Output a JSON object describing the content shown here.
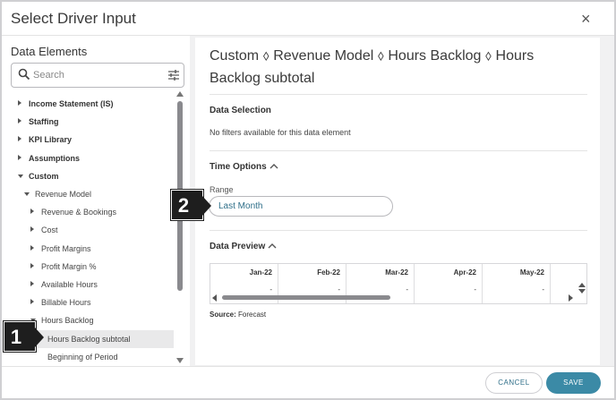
{
  "dialog": {
    "title": "Select Driver Input",
    "close_symbol": "×"
  },
  "left": {
    "title": "Data Elements",
    "search_placeholder": "Search",
    "tree": [
      {
        "label": "Income Statement (IS)",
        "level": 0,
        "state": "collapsed"
      },
      {
        "label": "Staffing",
        "level": 0,
        "state": "collapsed"
      },
      {
        "label": "KPI Library",
        "level": 0,
        "state": "collapsed"
      },
      {
        "label": "Assumptions",
        "level": 0,
        "state": "collapsed"
      },
      {
        "label": "Custom",
        "level": 0,
        "state": "expanded"
      },
      {
        "label": "Revenue Model",
        "level": 1,
        "state": "expanded"
      },
      {
        "label": "Revenue & Bookings",
        "level": 2,
        "state": "collapsed"
      },
      {
        "label": "Cost",
        "level": 2,
        "state": "collapsed"
      },
      {
        "label": "Profit Margins",
        "level": 2,
        "state": "collapsed"
      },
      {
        "label": "Profit Margin %",
        "level": 2,
        "state": "collapsed"
      },
      {
        "label": "Available Hours",
        "level": 2,
        "state": "collapsed"
      },
      {
        "label": "Billable Hours",
        "level": 2,
        "state": "collapsed"
      },
      {
        "label": "Hours Backlog",
        "level": 2,
        "state": "expanded"
      },
      {
        "label": "Hours Backlog subtotal",
        "level": 3,
        "state": "leaf",
        "selected": true
      },
      {
        "label": "Beginning of Period",
        "level": 3,
        "state": "leaf"
      }
    ]
  },
  "right": {
    "heading": "Custom ⬨ Revenue Model ⬨ Hours Backlog ⬨ Hours Backlog subtotal",
    "data_selection": {
      "title": "Data Selection",
      "note": "No filters available for this data element"
    },
    "time_options": {
      "title": "Time Options",
      "range_label": "Range",
      "range_value": "Last Month"
    },
    "data_preview": {
      "title": "Data Preview",
      "columns": [
        {
          "header": "Jan-22",
          "value": "-"
        },
        {
          "header": "Feb-22",
          "value": "-"
        },
        {
          "header": "Mar-22",
          "value": "-"
        },
        {
          "header": "Apr-22",
          "value": "-"
        },
        {
          "header": "May-22",
          "value": "-"
        },
        {
          "header": "J",
          "value": ""
        }
      ],
      "source_label": "Source:",
      "source_value": "Forecast"
    }
  },
  "footer": {
    "cancel": "CANCEL",
    "save": "SAVE"
  },
  "callouts": [
    "1",
    "2"
  ],
  "colors": {
    "accent": "#3b8aa6",
    "link": "#2f6f89"
  }
}
